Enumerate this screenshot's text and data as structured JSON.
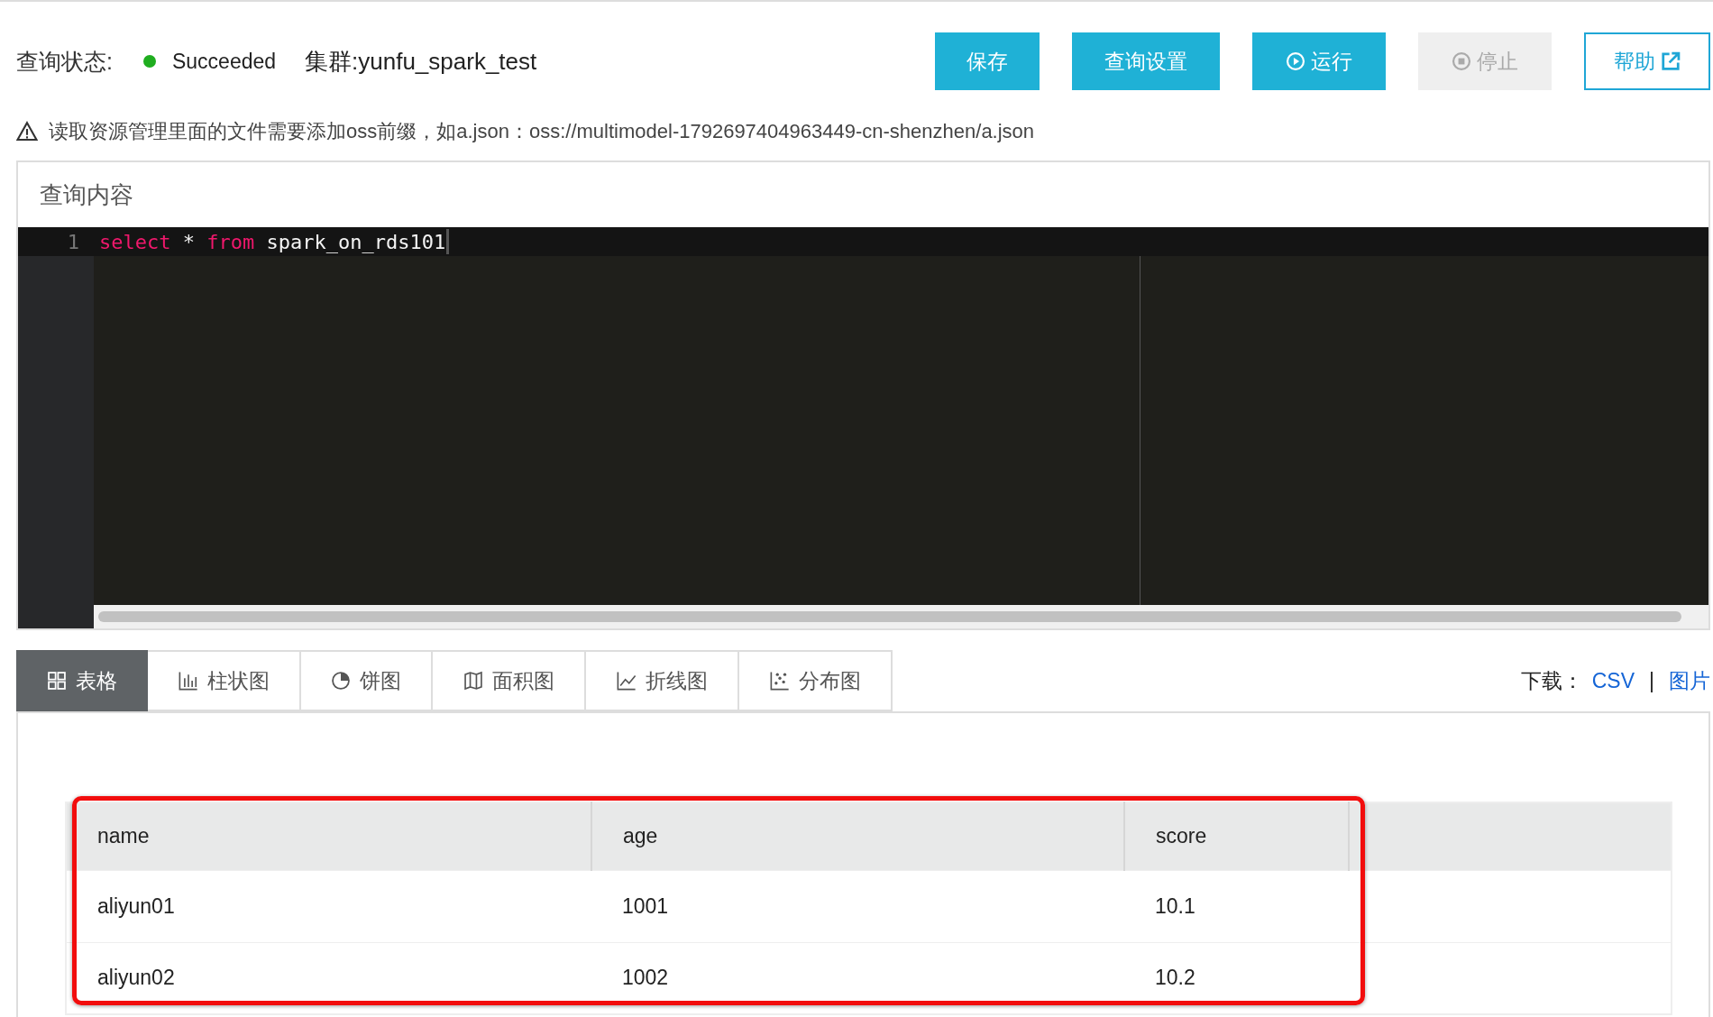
{
  "status_bar": {
    "label": "查询状态:",
    "value": "Succeeded",
    "cluster": "集群:yunfu_spark_test"
  },
  "buttons": [
    {
      "label": "保存",
      "kind": "filled",
      "disabled": false
    },
    {
      "label": "查询设置",
      "kind": "filled",
      "disabled": false
    },
    {
      "label": "运行",
      "kind": "filled",
      "disabled": false
    },
    {
      "label": "停止",
      "kind": "filled",
      "disabled": true
    },
    {
      "label": "帮助",
      "kind": "outline",
      "disabled": false
    }
  ],
  "notice": "读取资源管理里面的文件需要添加oss前缀，如a.json：oss://multimodel-1792697404963449-cn-shenzhen/a.json",
  "editor": {
    "title": "查询内容",
    "lines": [
      {
        "number": "1",
        "tokens": [
          {
            "text": "select",
            "kind": "keyword"
          },
          {
            "text": " * ",
            "kind": "plain"
          },
          {
            "text": "from",
            "kind": "keyword"
          },
          {
            "text": " spark_on_rds101",
            "kind": "plain"
          }
        ]
      }
    ]
  },
  "result_tabs": [
    {
      "label": "表格",
      "selected": true
    },
    {
      "label": "柱状图",
      "selected": false
    },
    {
      "label": "饼图",
      "selected": false
    },
    {
      "label": "面积图",
      "selected": false
    },
    {
      "label": "折线图",
      "selected": false
    },
    {
      "label": "分布图",
      "selected": false
    }
  ],
  "download": {
    "label": "下载：",
    "links": [
      "CSV",
      "图片"
    ],
    "separator": "|"
  },
  "table": {
    "columns": [
      "name",
      "age",
      "score"
    ],
    "rows": [
      [
        "aliyun01",
        "1001",
        "10.1"
      ],
      [
        "aliyun02",
        "1002",
        "10.2"
      ]
    ],
    "highlighted": true
  }
}
